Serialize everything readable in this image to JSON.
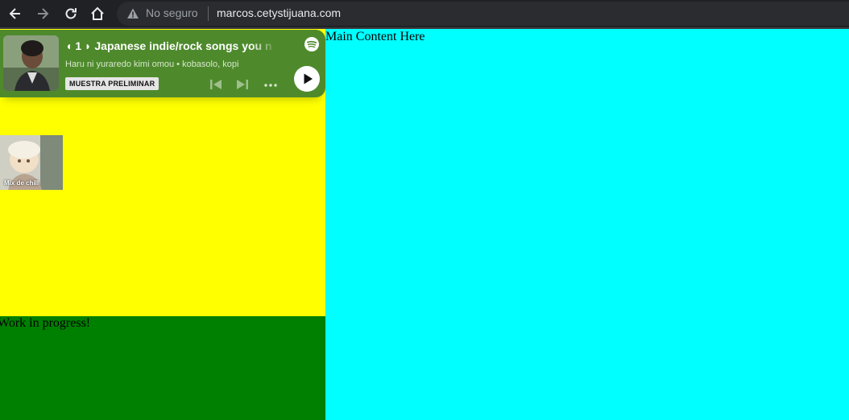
{
  "browser": {
    "insecure_label": "No seguro",
    "url": "marcos.cetystijuana.com"
  },
  "spotify": {
    "track_title": "◖ 1 ◗ Japanese indie/rock songs you n",
    "track_artists": "Haru ni yuraredo kimi omou  •  kobasolo, kopi",
    "preview_badge": "MUESTRA PRELIMINAR",
    "background_color": "#4e8a2c"
  },
  "mix_thumbnail": {
    "label": "Mix de chill"
  },
  "main": {
    "text": "Main Content Here"
  },
  "footer": {
    "text": "Work in progress!"
  },
  "colors": {
    "left_column": "#ffff00",
    "footer": "#008000",
    "main": "#00ffff"
  }
}
